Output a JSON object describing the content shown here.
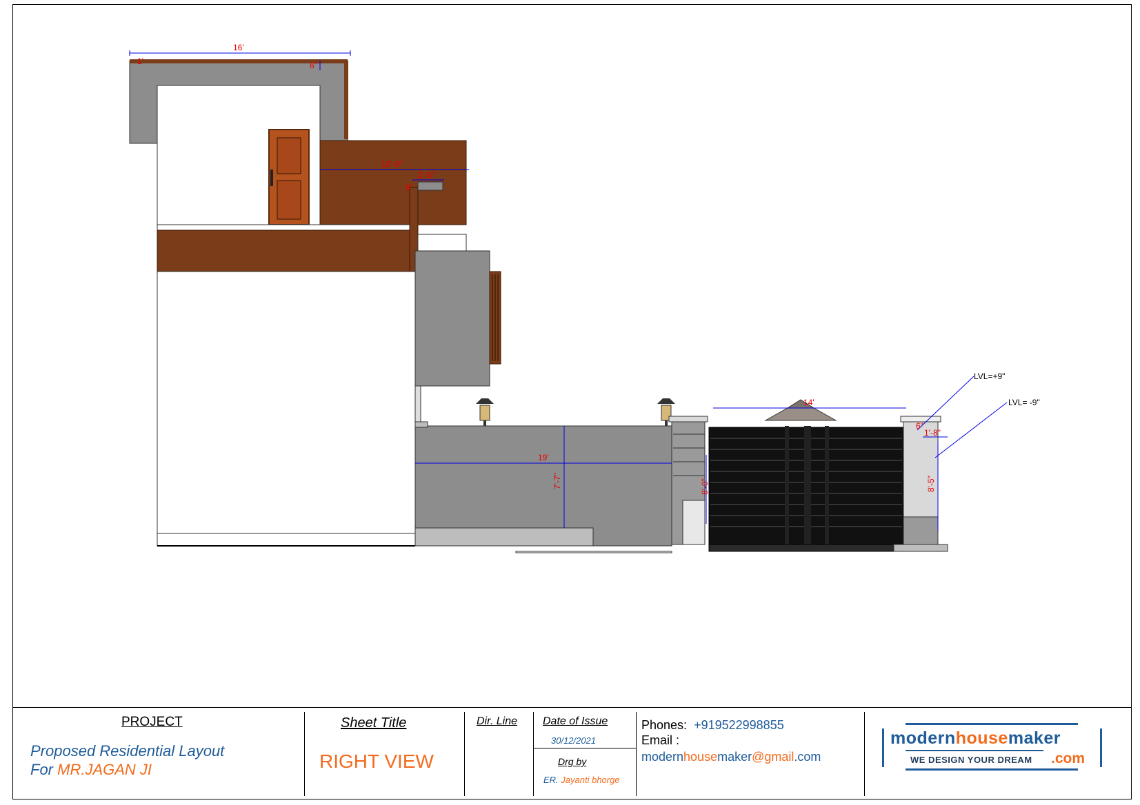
{
  "drawing": {
    "view": "right elevation",
    "dimensions": {
      "top_width": "16'",
      "top_small_left": "1'",
      "top_small_right": "6\"",
      "balcony_width": "10'-6\"",
      "small_overhang": "2'-6\"",
      "small_tag": "6\"",
      "wall_length": "19'",
      "wall_height": "7'-7\"",
      "gate_width": "14'",
      "gate_height": "8'-0\"",
      "pillar_top": "6\"",
      "pillar_width": "1'-8\"",
      "pillar_height": "8'-5\""
    },
    "levels": {
      "upper": "LVL=+9\"",
      "lower": "LVL= -9\""
    },
    "colors": {
      "wood": "#7a3c19",
      "wall_grey": "#8d8d8d",
      "light_grey": "#bdbdbd",
      "gate_black": "#111111",
      "dim_blue": "#0000e6",
      "dim_red": "#e60000",
      "door_orange": "#b5531e"
    }
  },
  "title_block": {
    "project": {
      "heading": "PROJECT",
      "line1": "Proposed Residential Layout",
      "line2_prefix": "For ",
      "client": "MR.JAGAN  JI"
    },
    "sheet_title": {
      "heading": "Sheet Title",
      "value": "RIGHT VIEW"
    },
    "dir_line": {
      "heading": "Dir. Line"
    },
    "date_of_issue": {
      "heading": "Date of Issue",
      "value": "30/12/2021"
    },
    "drawn_by": {
      "heading": "Drg by",
      "prefix": "ER. ",
      "name": "Jayanti bhorge"
    },
    "contact": {
      "phones_label": "Phones:",
      "phone": "+919522998855",
      "email_label": "Email :",
      "email_part1": "modern",
      "email_part2": "house",
      "email_part3": "maker",
      "email_part4": "@gmail",
      "email_part5": ".com"
    },
    "logo": {
      "word1": "modern",
      "word2": "house",
      "word3": "maker",
      "tagline": "WE DESIGN YOUR DREAM",
      "suffix": ".com"
    }
  }
}
